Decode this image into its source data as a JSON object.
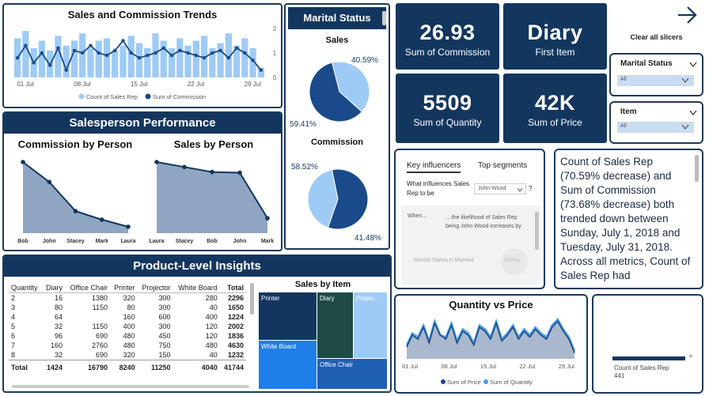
{
  "trends": {
    "title": "Sales and Commission Trends",
    "x_ticks": [
      "01 Jul",
      "08 Jul",
      "15 Jul",
      "22 Jul",
      "29 Jul"
    ],
    "y_ticks": [
      "2",
      "1",
      "0"
    ],
    "legend": [
      "Count of Sales Rep",
      "Sum of Commission"
    ],
    "bars": [
      1.6,
      1.9,
      1.2,
      1.5,
      1.1,
      1.7,
      1.3,
      1.5,
      1.8,
      1.2,
      1.5,
      1.6,
      1.1,
      1.3,
      1.7,
      1.4,
      1.2,
      1.8,
      1.5,
      1.2,
      1.6,
      1.3,
      1.5,
      1.7,
      1.2,
      1.4,
      1.8,
      1.3,
      1.6,
      1.2,
      0.4
    ],
    "line": [
      0.8,
      1.3,
      0.6,
      1.0,
      0.5,
      1.2,
      0.3,
      1.1,
      1.0,
      1.3,
      1.0,
      0.9,
      1.1,
      1.5,
      1.0,
      0.8,
      0.9,
      1.0,
      1.2,
      0.9,
      1.1,
      1.0,
      0.9,
      0.8,
      1.0,
      1.1,
      0.8,
      1.2,
      1.0,
      0.7,
      0.3
    ]
  },
  "salesperson": {
    "banner": "Salesperson Performance",
    "commission_title": "Commission by Person",
    "sales_title": "Sales by Person",
    "commission_names": [
      "Bob",
      "John",
      "Stacey",
      "Mark",
      "Laura"
    ],
    "commission_values": [
      100,
      72,
      31,
      19,
      9
    ],
    "sales_names": [
      "Laura",
      "Stacey",
      "Bob",
      "John",
      "Mark"
    ],
    "sales_values": [
      100,
      93,
      86,
      85,
      21
    ]
  },
  "marital": {
    "banner": "Marital Status",
    "sales_title": "Sales",
    "sales_labels": [
      "40.59%",
      "59.41%"
    ],
    "sales_values": [
      40.59,
      59.41
    ],
    "commission_title": "Commission",
    "commission_labels": [
      "58.52%",
      "41.48%"
    ],
    "commission_values": [
      58.52,
      41.48
    ]
  },
  "kpis": [
    {
      "value": "26.93",
      "label": "Sum of Commission"
    },
    {
      "value": "Diary",
      "label": "First Item"
    },
    {
      "value": "5509",
      "label": "Sum of Quantity"
    },
    {
      "value": "42K",
      "label": "Sum of Price"
    }
  ],
  "clear_slicers": "Clear all slicers",
  "slicers": [
    {
      "title": "Marital Status",
      "value": "All"
    },
    {
      "title": "Item",
      "value": "All"
    }
  ],
  "key_influencers": {
    "tab1": "Key influencers",
    "tab2": "Top segments",
    "question": "What influences Sales Rep to be",
    "dropdown": "John Wood",
    "help": "?",
    "col_when": "When...",
    "col_likelihood": "....the likelihood of Sales Rep being John Wood increases by",
    "factor": "Marital Status is Married",
    "factor_value": "Infinity"
  },
  "narrative": {
    "text": "Count of Sales Rep (70.59% decrease) and Sum of Commission (73.68% decrease) both trended down between Sunday, July 1, 2018 and Tuesday, July 31, 2018. Across all metrics, Count of Sales Rep had"
  },
  "product": {
    "banner": "Product-Level Insights",
    "headers": [
      "Quantity",
      "Diary",
      "Office Chair",
      "Printer",
      "Projector",
      "White Board",
      "Total"
    ],
    "rows": [
      [
        "2",
        "16",
        "1380",
        "320",
        "300",
        "280",
        "2296"
      ],
      [
        "3",
        "80",
        "1150",
        "80",
        "300",
        "40",
        "1650"
      ],
      [
        "4",
        "64",
        "",
        "160",
        "600",
        "400",
        "1224"
      ],
      [
        "5",
        "32",
        "1150",
        "400",
        "300",
        "120",
        "2002"
      ],
      [
        "6",
        "96",
        "690",
        "480",
        "450",
        "120",
        "1836"
      ],
      [
        "7",
        "160",
        "2760",
        "480",
        "750",
        "480",
        "4630"
      ],
      [
        "8",
        "32",
        "690",
        "320",
        "150",
        "40",
        "1232"
      ]
    ],
    "total": [
      "Total",
      "1424",
      "16790",
      "8240",
      "11250",
      "4040",
      "41744"
    ],
    "treemap_title": "Sales by Item",
    "treemap_labels": [
      "Printer",
      "Diary",
      "Projec...",
      "White Board",
      "Office Chair"
    ]
  },
  "qvp": {
    "title": "Quantity vs Price",
    "x_ticks": [
      "01 Jul",
      "08 Jul",
      "15 Jul",
      "22 Jul",
      "29 Jul"
    ],
    "legend": [
      "Sum of Price",
      "Sum of Quantity"
    ],
    "price": [
      0.3,
      0.6,
      0.5,
      0.8,
      0.4,
      0.9,
      0.6,
      0.5,
      0.85,
      0.4,
      0.7,
      0.6,
      0.35,
      0.8,
      0.7,
      0.5,
      0.9,
      0.45,
      0.6,
      0.8,
      0.5,
      0.7,
      0.55,
      0.75,
      0.6,
      0.5,
      0.8,
      0.95,
      0.7,
      0.5,
      0.15
    ],
    "quantity": [
      0.35,
      0.65,
      0.55,
      0.85,
      0.45,
      0.95,
      0.6,
      0.55,
      0.9,
      0.45,
      0.75,
      0.65,
      0.4,
      0.85,
      0.75,
      0.55,
      0.95,
      0.5,
      0.65,
      0.85,
      0.55,
      0.75,
      0.6,
      0.8,
      0.65,
      0.55,
      0.85,
      1.0,
      0.75,
      0.55,
      0.2
    ]
  },
  "mini": {
    "label": "Count of Sales Rep",
    "value": "441",
    "plus": "+"
  },
  "colors": {
    "navy": "#13365f",
    "bar_light": "#9ecbf5",
    "line_dark": "#1a4a8a",
    "area_fill": "#8fa6c2",
    "price_line": "#1a4a8a",
    "qty_line": "#4a9be8"
  }
}
